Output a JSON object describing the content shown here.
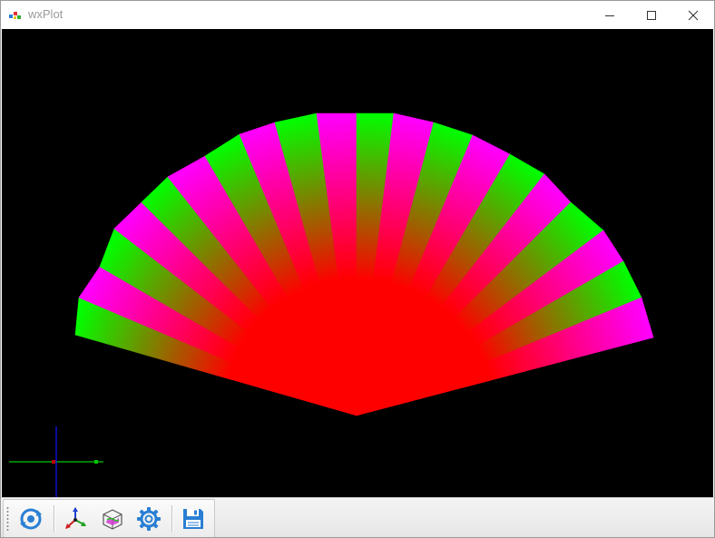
{
  "window": {
    "title": "wxPlot"
  },
  "colors": {
    "tip_green": "#00ff00",
    "tip_magenta": "#ff00ff",
    "center_red": "#ff0000",
    "background": "#000000",
    "axis_x": "#00c800",
    "axis_y": "#0000ff",
    "toolbar_icon_blue": "#2a7fd4"
  },
  "toolbar": {
    "buttons": [
      {
        "name": "rotate-view-button",
        "icon": "rotate-icon"
      },
      {
        "name": "axes-button",
        "icon": "axes-icon"
      },
      {
        "name": "bounding-box-button",
        "icon": "box-icon"
      },
      {
        "name": "settings-button",
        "icon": "gear-icon"
      },
      {
        "name": "save-button",
        "icon": "floppy-disk-icon"
      }
    ]
  }
}
